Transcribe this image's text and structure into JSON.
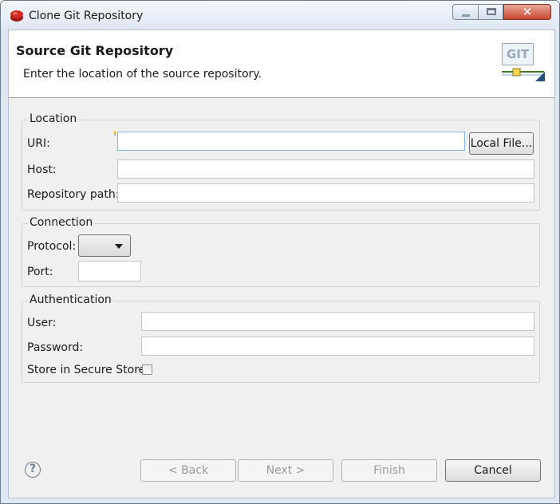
{
  "window": {
    "title": "Clone Git Repository",
    "close_glyph": "✕"
  },
  "header": {
    "title": "Source Git Repository",
    "description": "Enter the location of the source repository.",
    "logo_text": "GIT"
  },
  "location": {
    "group_label": "Location",
    "uri_label": "URI:",
    "uri_value": "",
    "local_file_button": "Local File...",
    "host_label": "Host:",
    "host_value": "",
    "repo_path_label": "Repository path:",
    "repo_path_value": ""
  },
  "connection": {
    "group_label": "Connection",
    "protocol_label": "Protocol:",
    "protocol_value": "",
    "port_label": "Port:",
    "port_value": ""
  },
  "authentication": {
    "group_label": "Authentication",
    "user_label": "User:",
    "user_value": "",
    "password_label": "Password:",
    "password_value": "",
    "secure_store_label": "Store in Secure Store",
    "secure_store_checked": false
  },
  "buttons": {
    "help_glyph": "?",
    "back": "< Back",
    "next": "Next >",
    "finish": "Finish",
    "cancel": "Cancel"
  },
  "icons": {
    "app": "eclipse-git-icon",
    "help": "help-icon",
    "banner": "git-logo-icon"
  },
  "colors": {
    "focus_border": "#7eb4ea",
    "close_button": "#c8472f"
  }
}
